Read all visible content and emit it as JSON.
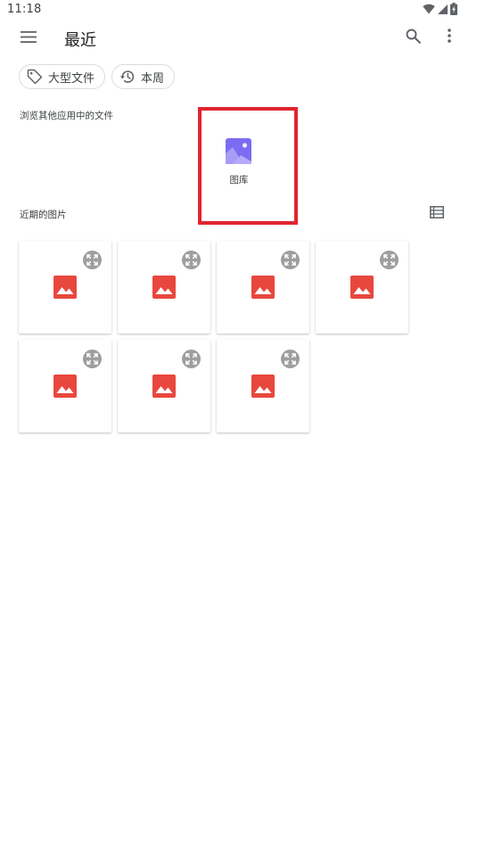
{
  "status_bar": {
    "time": "11:18",
    "icons": [
      "wifi-icon",
      "cellular-signal-icon",
      "battery-charging-icon"
    ]
  },
  "app_bar": {
    "title": "最近",
    "icons": [
      "menu-icon",
      "search-icon",
      "more-vert-icon"
    ]
  },
  "chips": [
    {
      "label": "大型文件",
      "icon": "tag-icon"
    },
    {
      "label": "本周",
      "icon": "history-icon"
    }
  ],
  "browse": {
    "label": "浏览其他应用中的文件",
    "apps": [
      {
        "label": "图库",
        "icon": "gallery-icon",
        "icon_color": "#7c6cf2"
      }
    ],
    "highlight_color": "#e0252f"
  },
  "recent": {
    "label": "近期的图片",
    "view_toggle_icon": "list-view-icon",
    "thumbnails": [
      {
        "icon": "image-icon",
        "overlay_icon": "expand-icon"
      },
      {
        "icon": "image-icon",
        "overlay_icon": "expand-icon"
      },
      {
        "icon": "image-icon",
        "overlay_icon": "expand-icon"
      },
      {
        "icon": "image-icon",
        "overlay_icon": "expand-icon"
      },
      {
        "icon": "image-icon",
        "overlay_icon": "expand-icon"
      },
      {
        "icon": "image-icon",
        "overlay_icon": "expand-icon"
      },
      {
        "icon": "image-icon",
        "overlay_icon": "expand-icon"
      }
    ],
    "image_icon_color": "#e8473e",
    "overlay_icon_color": "#9e9e9e"
  }
}
